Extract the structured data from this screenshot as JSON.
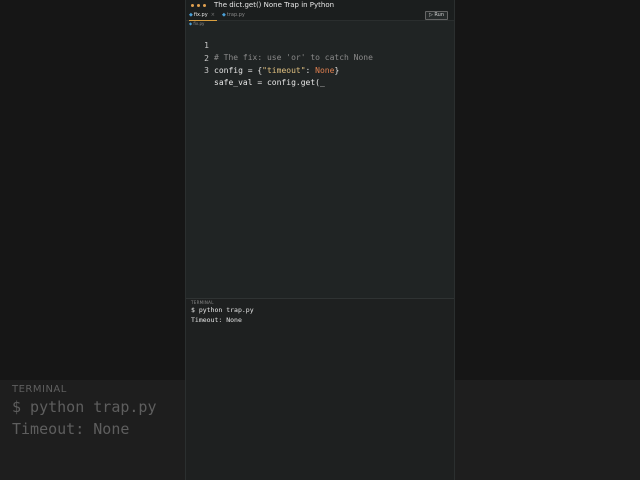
{
  "window": {
    "title": "The dict.get() None Trap in Python"
  },
  "tabs": [
    {
      "label": "fix.py",
      "active": true
    },
    {
      "label": "trap.py",
      "active": false
    }
  ],
  "toolbar": {
    "run_label": "Run"
  },
  "breadcrumb": "fix.py",
  "editor": {
    "lines": [
      {
        "number": "1",
        "tokens": [
          "# The fix: use 'or' to catch None"
        ]
      },
      {
        "number": "2",
        "tokens": [
          "config = {",
          "\"timeout\"",
          ": ",
          "None",
          "}"
        ]
      },
      {
        "number": "3",
        "tokens": [
          "safe_val = config.get(_"
        ]
      }
    ]
  },
  "terminal": {
    "title": "TERMINAL",
    "lines": [
      "$ python trap.py",
      "Timeout: None"
    ]
  },
  "colors": {
    "accent": "#d9a040",
    "string": "#e0c080",
    "keyword": "#e08050",
    "comment": "#8a8a8a"
  }
}
